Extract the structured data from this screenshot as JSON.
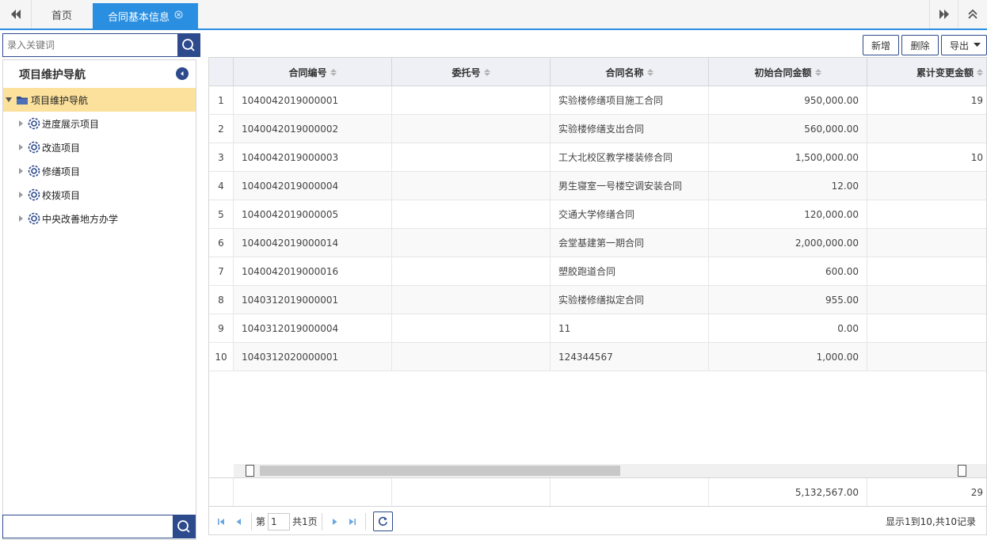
{
  "tabs": {
    "home": "首页",
    "active": "合同基本信息"
  },
  "search": {
    "placeholder": "录入关键词"
  },
  "nav": {
    "title": "项目维护导航",
    "root": "项目维护导航",
    "items": [
      "进度展示项目",
      "改造项目",
      "修缮项目",
      "校拨项目",
      "中央改善地方办学"
    ]
  },
  "toolbar": {
    "add": "新增",
    "delete": "删除",
    "export": "导出"
  },
  "grid": {
    "columns": [
      "合同编号",
      "委托号",
      "合同名称",
      "初始合同金额",
      "累计变更金额"
    ],
    "rows": [
      {
        "idx": "1",
        "no": "1040042019000001",
        "wt": "",
        "name": "实验楼修缮项目施工合同",
        "amt": "950,000.00",
        "chg": "19"
      },
      {
        "idx": "2",
        "no": "1040042019000002",
        "wt": "",
        "name": "实验楼修缮支出合同",
        "amt": "560,000.00",
        "chg": ""
      },
      {
        "idx": "3",
        "no": "1040042019000003",
        "wt": "",
        "name": "工大北校区教学楼装修合同",
        "amt": "1,500,000.00",
        "chg": "10"
      },
      {
        "idx": "4",
        "no": "1040042019000004",
        "wt": "",
        "name": "男生寝室一号楼空调安装合同",
        "amt": "12.00",
        "chg": ""
      },
      {
        "idx": "5",
        "no": "1040042019000005",
        "wt": "",
        "name": "交通大学修缮合同",
        "amt": "120,000.00",
        "chg": ""
      },
      {
        "idx": "6",
        "no": "1040042019000014",
        "wt": "",
        "name": "会堂基建第一期合同",
        "amt": "2,000,000.00",
        "chg": ""
      },
      {
        "idx": "7",
        "no": "1040042019000016",
        "wt": "",
        "name": "塑胶跑道合同",
        "amt": "600.00",
        "chg": ""
      },
      {
        "idx": "8",
        "no": "1040312019000001",
        "wt": "",
        "name": "实验楼修缮拟定合同",
        "amt": "955.00",
        "chg": ""
      },
      {
        "idx": "9",
        "no": "1040312019000004",
        "wt": "",
        "name": "11",
        "amt": "0.00",
        "chg": ""
      },
      {
        "idx": "10",
        "no": "1040312020000001",
        "wt": "",
        "name": "124344567",
        "amt": "1,000.00",
        "chg": ""
      }
    ],
    "totals": {
      "amt": "5,132,567.00",
      "chg": "29"
    }
  },
  "pager": {
    "page_prefix": "第",
    "page": "1",
    "total_pages": "共1页",
    "info": "显示1到10,共10记录"
  }
}
